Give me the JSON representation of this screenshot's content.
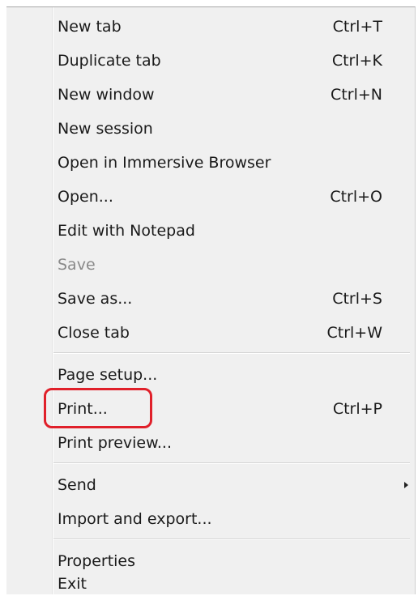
{
  "menu": {
    "items": [
      {
        "label": "New tab",
        "shortcut": "Ctrl+T"
      },
      {
        "label": "Duplicate tab",
        "shortcut": "Ctrl+K"
      },
      {
        "label": "New window",
        "shortcut": "Ctrl+N"
      },
      {
        "label": "New session",
        "shortcut": ""
      },
      {
        "label": "Open in Immersive Browser",
        "shortcut": ""
      },
      {
        "label": "Open...",
        "shortcut": "Ctrl+O"
      },
      {
        "label": "Edit with Notepad",
        "shortcut": ""
      },
      {
        "label": "Save",
        "shortcut": "",
        "disabled": true
      },
      {
        "label": "Save as...",
        "shortcut": "Ctrl+S"
      },
      {
        "label": "Close tab",
        "shortcut": "Ctrl+W"
      },
      {
        "label": "Page setup...",
        "shortcut": ""
      },
      {
        "label": "Print...",
        "shortcut": "Ctrl+P",
        "highlighted": true
      },
      {
        "label": "Print preview...",
        "shortcut": ""
      },
      {
        "label": "Send",
        "shortcut": "",
        "submenu": true
      },
      {
        "label": "Import and export...",
        "shortcut": ""
      },
      {
        "label": "Properties",
        "shortcut": ""
      },
      {
        "label": "Exit",
        "shortcut": ""
      }
    ]
  },
  "colors": {
    "menu_background": "#f0f0f0",
    "highlight_border": "#e0202a",
    "disabled_text": "#8a8a8a"
  },
  "icons": {
    "submenu_arrow": "chevron-right-icon"
  }
}
